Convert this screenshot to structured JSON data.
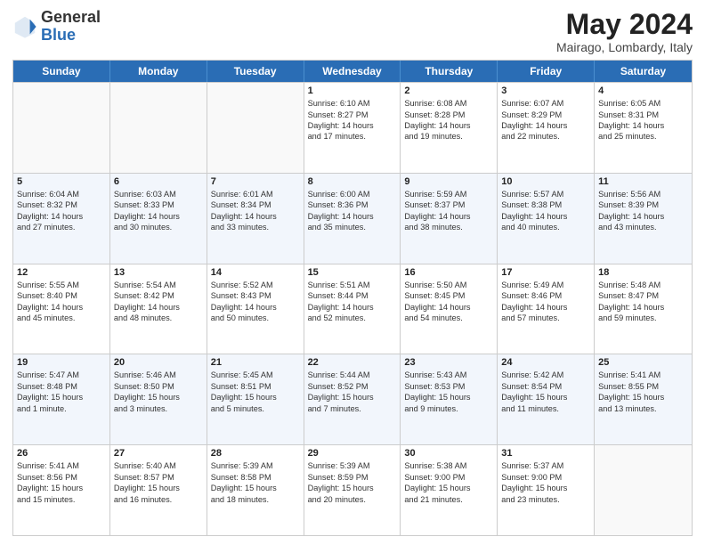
{
  "header": {
    "logo_line1": "General",
    "logo_line2": "Blue",
    "month_year": "May 2024",
    "location": "Mairago, Lombardy, Italy"
  },
  "days_of_week": [
    "Sunday",
    "Monday",
    "Tuesday",
    "Wednesday",
    "Thursday",
    "Friday",
    "Saturday"
  ],
  "rows": [
    {
      "alt": false,
      "cells": [
        {
          "num": "",
          "lines": []
        },
        {
          "num": "",
          "lines": []
        },
        {
          "num": "",
          "lines": []
        },
        {
          "num": "1",
          "lines": [
            "Sunrise: 6:10 AM",
            "Sunset: 8:27 PM",
            "Daylight: 14 hours",
            "and 17 minutes."
          ]
        },
        {
          "num": "2",
          "lines": [
            "Sunrise: 6:08 AM",
            "Sunset: 8:28 PM",
            "Daylight: 14 hours",
            "and 19 minutes."
          ]
        },
        {
          "num": "3",
          "lines": [
            "Sunrise: 6:07 AM",
            "Sunset: 8:29 PM",
            "Daylight: 14 hours",
            "and 22 minutes."
          ]
        },
        {
          "num": "4",
          "lines": [
            "Sunrise: 6:05 AM",
            "Sunset: 8:31 PM",
            "Daylight: 14 hours",
            "and 25 minutes."
          ]
        }
      ]
    },
    {
      "alt": true,
      "cells": [
        {
          "num": "5",
          "lines": [
            "Sunrise: 6:04 AM",
            "Sunset: 8:32 PM",
            "Daylight: 14 hours",
            "and 27 minutes."
          ]
        },
        {
          "num": "6",
          "lines": [
            "Sunrise: 6:03 AM",
            "Sunset: 8:33 PM",
            "Daylight: 14 hours",
            "and 30 minutes."
          ]
        },
        {
          "num": "7",
          "lines": [
            "Sunrise: 6:01 AM",
            "Sunset: 8:34 PM",
            "Daylight: 14 hours",
            "and 33 minutes."
          ]
        },
        {
          "num": "8",
          "lines": [
            "Sunrise: 6:00 AM",
            "Sunset: 8:36 PM",
            "Daylight: 14 hours",
            "and 35 minutes."
          ]
        },
        {
          "num": "9",
          "lines": [
            "Sunrise: 5:59 AM",
            "Sunset: 8:37 PM",
            "Daylight: 14 hours",
            "and 38 minutes."
          ]
        },
        {
          "num": "10",
          "lines": [
            "Sunrise: 5:57 AM",
            "Sunset: 8:38 PM",
            "Daylight: 14 hours",
            "and 40 minutes."
          ]
        },
        {
          "num": "11",
          "lines": [
            "Sunrise: 5:56 AM",
            "Sunset: 8:39 PM",
            "Daylight: 14 hours",
            "and 43 minutes."
          ]
        }
      ]
    },
    {
      "alt": false,
      "cells": [
        {
          "num": "12",
          "lines": [
            "Sunrise: 5:55 AM",
            "Sunset: 8:40 PM",
            "Daylight: 14 hours",
            "and 45 minutes."
          ]
        },
        {
          "num": "13",
          "lines": [
            "Sunrise: 5:54 AM",
            "Sunset: 8:42 PM",
            "Daylight: 14 hours",
            "and 48 minutes."
          ]
        },
        {
          "num": "14",
          "lines": [
            "Sunrise: 5:52 AM",
            "Sunset: 8:43 PM",
            "Daylight: 14 hours",
            "and 50 minutes."
          ]
        },
        {
          "num": "15",
          "lines": [
            "Sunrise: 5:51 AM",
            "Sunset: 8:44 PM",
            "Daylight: 14 hours",
            "and 52 minutes."
          ]
        },
        {
          "num": "16",
          "lines": [
            "Sunrise: 5:50 AM",
            "Sunset: 8:45 PM",
            "Daylight: 14 hours",
            "and 54 minutes."
          ]
        },
        {
          "num": "17",
          "lines": [
            "Sunrise: 5:49 AM",
            "Sunset: 8:46 PM",
            "Daylight: 14 hours",
            "and 57 minutes."
          ]
        },
        {
          "num": "18",
          "lines": [
            "Sunrise: 5:48 AM",
            "Sunset: 8:47 PM",
            "Daylight: 14 hours",
            "and 59 minutes."
          ]
        }
      ]
    },
    {
      "alt": true,
      "cells": [
        {
          "num": "19",
          "lines": [
            "Sunrise: 5:47 AM",
            "Sunset: 8:48 PM",
            "Daylight: 15 hours",
            "and 1 minute."
          ]
        },
        {
          "num": "20",
          "lines": [
            "Sunrise: 5:46 AM",
            "Sunset: 8:50 PM",
            "Daylight: 15 hours",
            "and 3 minutes."
          ]
        },
        {
          "num": "21",
          "lines": [
            "Sunrise: 5:45 AM",
            "Sunset: 8:51 PM",
            "Daylight: 15 hours",
            "and 5 minutes."
          ]
        },
        {
          "num": "22",
          "lines": [
            "Sunrise: 5:44 AM",
            "Sunset: 8:52 PM",
            "Daylight: 15 hours",
            "and 7 minutes."
          ]
        },
        {
          "num": "23",
          "lines": [
            "Sunrise: 5:43 AM",
            "Sunset: 8:53 PM",
            "Daylight: 15 hours",
            "and 9 minutes."
          ]
        },
        {
          "num": "24",
          "lines": [
            "Sunrise: 5:42 AM",
            "Sunset: 8:54 PM",
            "Daylight: 15 hours",
            "and 11 minutes."
          ]
        },
        {
          "num": "25",
          "lines": [
            "Sunrise: 5:41 AM",
            "Sunset: 8:55 PM",
            "Daylight: 15 hours",
            "and 13 minutes."
          ]
        }
      ]
    },
    {
      "alt": false,
      "cells": [
        {
          "num": "26",
          "lines": [
            "Sunrise: 5:41 AM",
            "Sunset: 8:56 PM",
            "Daylight: 15 hours",
            "and 15 minutes."
          ]
        },
        {
          "num": "27",
          "lines": [
            "Sunrise: 5:40 AM",
            "Sunset: 8:57 PM",
            "Daylight: 15 hours",
            "and 16 minutes."
          ]
        },
        {
          "num": "28",
          "lines": [
            "Sunrise: 5:39 AM",
            "Sunset: 8:58 PM",
            "Daylight: 15 hours",
            "and 18 minutes."
          ]
        },
        {
          "num": "29",
          "lines": [
            "Sunrise: 5:39 AM",
            "Sunset: 8:59 PM",
            "Daylight: 15 hours",
            "and 20 minutes."
          ]
        },
        {
          "num": "30",
          "lines": [
            "Sunrise: 5:38 AM",
            "Sunset: 9:00 PM",
            "Daylight: 15 hours",
            "and 21 minutes."
          ]
        },
        {
          "num": "31",
          "lines": [
            "Sunrise: 5:37 AM",
            "Sunset: 9:00 PM",
            "Daylight: 15 hours",
            "and 23 minutes."
          ]
        },
        {
          "num": "",
          "lines": []
        }
      ]
    }
  ]
}
